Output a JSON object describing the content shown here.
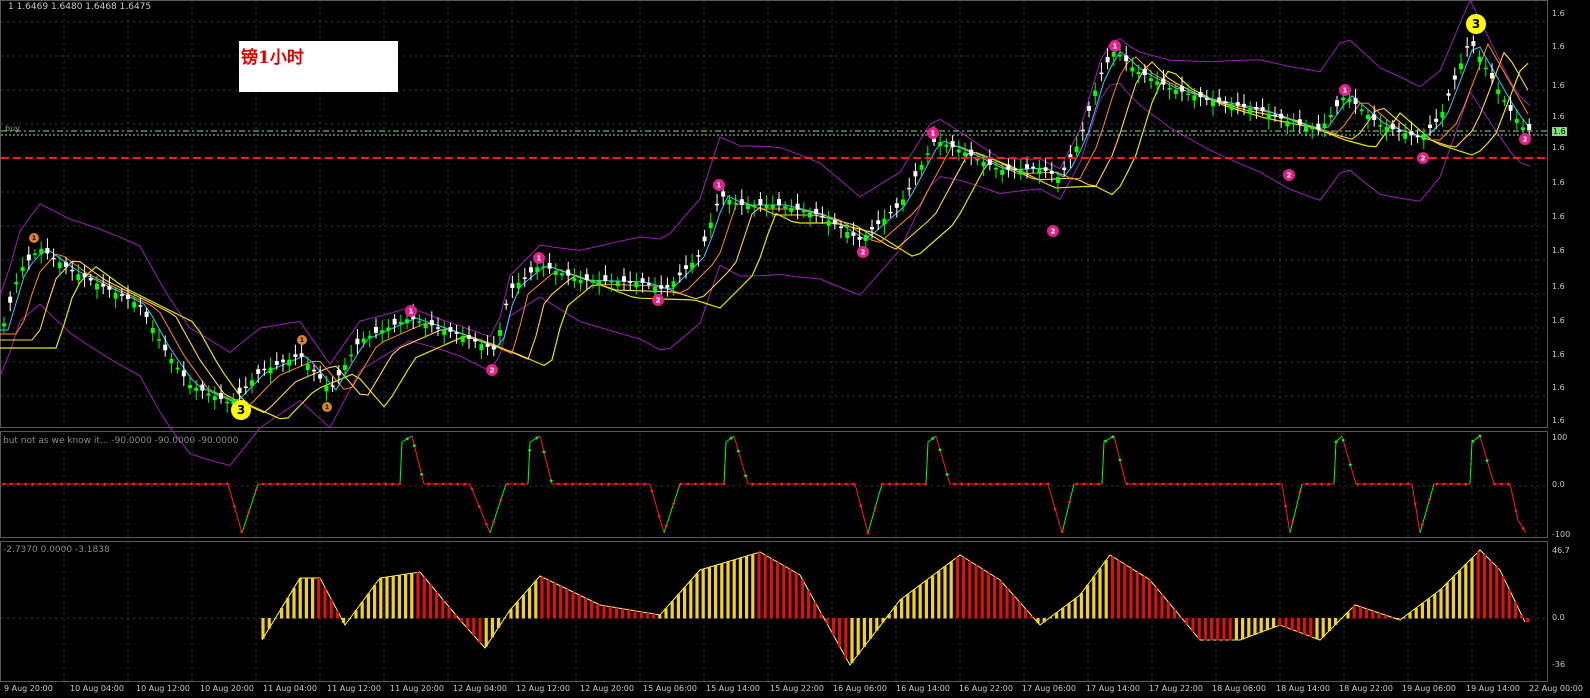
{
  "header": {
    "ohlc_text": "1  1.6469 1.6480 1.6468 1.6475",
    "title_box": "镑1小时",
    "buy_label": "buy"
  },
  "price_axis": {
    "labels": [
      "1.6",
      "1.6",
      "1.6",
      "1.6",
      "1.6",
      "1.6",
      "1.6",
      "1.6",
      "1.6",
      "1.6",
      "1.6",
      "1.6",
      "1.6"
    ],
    "current_label": "1.6"
  },
  "indicator1": {
    "label": "but not as we know it... -90.0000 -90.0000 -90.0000",
    "axis": [
      "100",
      "0.0",
      "-100"
    ]
  },
  "indicator2": {
    "label": "-2.7370 0.0000 -3.1838",
    "axis": [
      "46.7",
      "0.0",
      "-36"
    ]
  },
  "time_axis": [
    "9 Aug 20:00",
    "10 Aug 04:00",
    "10 Aug 12:00",
    "10 Aug 20:00",
    "11 Aug 04:00",
    "11 Aug 12:00",
    "11 Aug 20:00",
    "12 Aug 04:00",
    "12 Aug 12:00",
    "12 Aug 20:00",
    "15 Aug 06:00",
    "15 Aug 14:00",
    "15 Aug 22:00",
    "16 Aug 06:00",
    "16 Aug 14:00",
    "16 Aug 22:00",
    "17 Aug 06:00",
    "17 Aug 14:00",
    "17 Aug 22:00",
    "18 Aug 06:00",
    "18 Aug 14:00",
    "18 Aug 22:00",
    "19 Aug 06:00",
    "19 Aug 14:00",
    "22 Aug 00:00"
  ],
  "markers": {
    "yellow_3": "3",
    "one": "1",
    "two": "2"
  },
  "colors": {
    "background": "#000000",
    "bull_candle": "#00ff00",
    "bear_candle": "#ffffff",
    "signal_line_red": "#ff1a1a",
    "buy_line_green": "#7ee07e",
    "histogram_up": "#f2d21b",
    "histogram_down": "#e01010",
    "bollinger": "#9b1fb5",
    "ma_yellow": "#e6e600",
    "ma_orange": "#ff8c1a",
    "ma_cyan": "#33ccff",
    "marker_pink": "#e0218a",
    "marker_orange": "#d9822b",
    "marker_yellow": "#ffff00"
  }
}
